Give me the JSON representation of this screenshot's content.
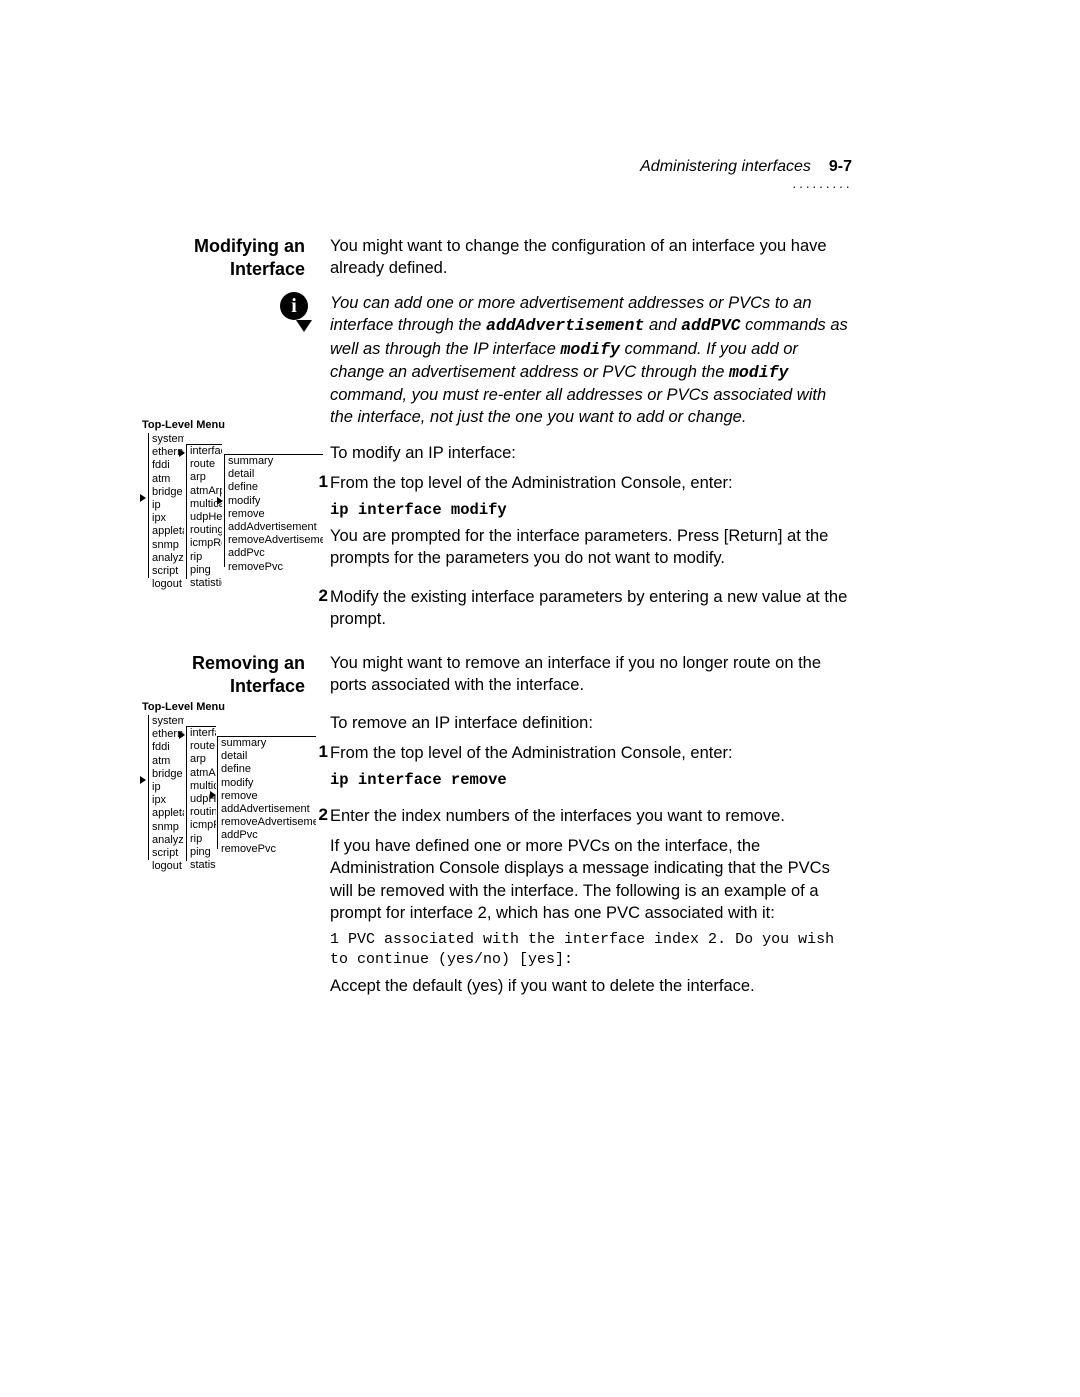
{
  "header": {
    "title": "Administering interfaces",
    "page": "9-7"
  },
  "section1": {
    "heading": "Modifying an Interface",
    "intro": "You might want to change the configuration of an interface you have already defined.",
    "note_pre": "You can add one or more advertisement addresses or PVCs to an interface through the ",
    "note_cmd1": "addAdvertisement",
    "note_mid1": " and ",
    "note_cmd2": "addPVC",
    "note_mid2": " commands as well as through the IP interface ",
    "note_cmd3": "modify",
    "note_mid3": " command. If you add or change an advertisement address or PVC through the ",
    "note_cmd4": "modify",
    "note_post": " command, you must re-enter all addresses or PVCs associated with the interface, not just the one you want to add or change.",
    "lead": "To modify an IP interface:",
    "step1_text": "From the top level of the Administration Console, enter:",
    "step1_cmd": "ip interface modify",
    "step1_after": "You are prompted for the interface parameters. Press [Return] at the prompts for the parameters you do not want to modify.",
    "step2_text": "Modify the existing interface parameters by entering a new value at the prompt."
  },
  "section2": {
    "heading": "Removing an Interface",
    "intro": "You might want to remove an interface if you no longer route on the ports associated with the interface.",
    "lead": "To remove an IP interface definition:",
    "step1_text": "From the top level of the Administration Console, enter:",
    "step1_cmd": "ip interface remove",
    "step2_text": "Enter the index numbers of the interfaces you want to remove.",
    "step2_after": "If you have defined one or more PVCs on the interface, the Administration Console displays a message indicating that the PVCs will be removed with the interface. The following is an example of a prompt for interface 2, which has one PVC associated with it:",
    "example": "1 PVC associated with the interface index 2. Do you wish to continue (yes/no) [yes]:",
    "accept": "Accept the default (yes) if you want to delete the interface."
  },
  "steps": {
    "one": "1",
    "two": "2"
  },
  "menu": {
    "title": "Top-Level Menu",
    "col1": [
      "system",
      "ethernet",
      "fddi",
      "atm",
      "bridge",
      "ip",
      "ipx",
      "appletalk",
      "snmp",
      "analyzer",
      "script",
      "logout"
    ],
    "col2a": [
      "interface",
      "route",
      "arp",
      "atmArpServer",
      "multicast",
      "udpHelper",
      "routing",
      "icmpRouterDiscovery",
      "rip",
      "ping",
      "statistics"
    ],
    "col2b": [
      "interface",
      "route",
      "arp",
      "atmArpServer",
      "multicast",
      "udpHelper",
      "routing",
      "icmpRouterDiscovery",
      "rip",
      "ping",
      "statistics"
    ],
    "col3a": [
      "summary",
      "detail",
      "define",
      "modify",
      "remove",
      "addAdvertisement",
      "removeAdvertisement",
      "addPvc",
      "removePvc"
    ],
    "col3b": [
      "summary",
      "detail",
      "define",
      "modify",
      "remove",
      "addAdvertisement",
      "removeAdvertisement",
      "addPvc",
      "removePvc"
    ]
  }
}
